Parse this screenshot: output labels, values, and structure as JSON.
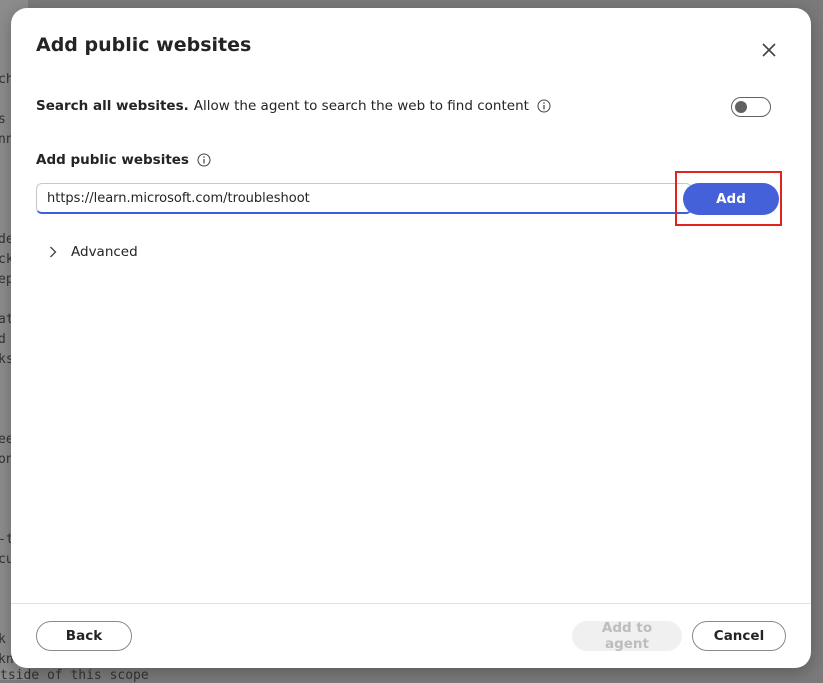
{
  "background": {
    "fragments": [
      "ch",
      "s",
      "nn",
      "de",
      "ck",
      "ep",
      "at",
      "d",
      "ks",
      "ee",
      "on",
      "-t",
      "cu",
      "k",
      "knc"
    ],
    "bottom_text": "tside of this scope"
  },
  "dialog": {
    "title": "Add public websites",
    "search": {
      "bold_label": "Search all websites.",
      "description": "Allow the agent to search the web to find content",
      "toggle_on": false
    },
    "websites_label": "Add public websites",
    "url_input": {
      "value": "https://learn.microsoft.com/troubleshoot"
    },
    "add_button": "Add",
    "advanced_label": "Advanced",
    "footer": {
      "back": "Back",
      "add_to_agent": "Add to agent",
      "cancel": "Cancel"
    }
  },
  "colors": {
    "primary": "#4461d9",
    "highlight": "#e0231d",
    "disabled_bg": "#f0f0f0",
    "disabled_text": "#bdbdbd"
  },
  "icons": [
    "close-icon",
    "info-icon",
    "chevron-right-icon"
  ]
}
